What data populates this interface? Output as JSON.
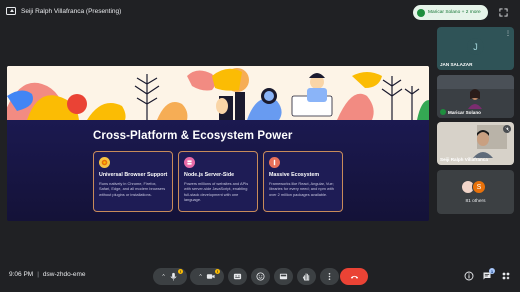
{
  "header": {
    "presenting_label": "Seiji Ralph Villafranca (Presenting)",
    "speaker_pill_text": "Maricar Solano + 2 more"
  },
  "slide": {
    "title": "Cross-Platform & Ecosystem Power",
    "cards": [
      {
        "icon": "chrome-icon",
        "title": "Universal Browser Support",
        "desc": "Runs natively in Chrome, Firefox, Safari, Edge, and all modern browsers without plugins or installations."
      },
      {
        "icon": "server-icon",
        "title": "Node.js Server-Side",
        "desc": "Powers millions of websites and APIs with server-side JavaScript, enabling full-stack development with one language."
      },
      {
        "icon": "ecosystem-icon",
        "title": "Massive Ecosystem",
        "desc": "Frameworks like React, Angular, Vue; libraries for every need; and npm with over 2 million packages available."
      }
    ]
  },
  "participants": {
    "tile1": {
      "initial": "J",
      "name": "JAN SALAZAR"
    },
    "tile2": {
      "name": "Maricar Solano"
    },
    "tile3": {
      "name": "Seiji Ralph Villafranca"
    },
    "others": {
      "initial": "S",
      "label": "81 others"
    }
  },
  "footer": {
    "time": "9:06 PM",
    "separator": "|",
    "meeting_code": "dsw-zhdo-eme",
    "chat_badge": "1"
  },
  "colors": {
    "background": "#202124",
    "end_call": "#ea4335",
    "speaking_green": "#1e8e3e",
    "card_border": "#c88b5a"
  }
}
